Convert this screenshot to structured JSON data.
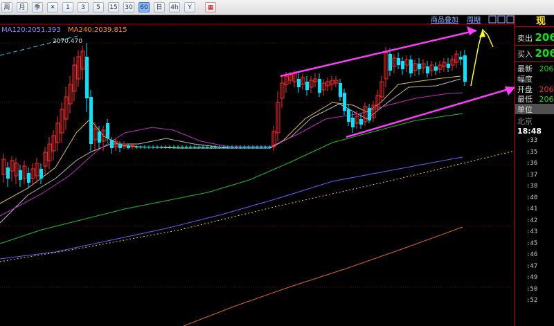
{
  "toolbar": {
    "buttons": [
      {
        "label": "周",
        "name": "weekly-period-button"
      },
      {
        "label": "月",
        "name": "monthly-period-button"
      },
      {
        "label": "季",
        "name": "quarter-period-button"
      },
      {
        "label": "✕",
        "name": "crosshair-button"
      },
      {
        "label": "1",
        "name": "period-1min-button"
      },
      {
        "label": "3",
        "name": "period-3min-button"
      },
      {
        "label": "5",
        "name": "period-5min-button"
      },
      {
        "label": "15",
        "name": "period-15min-button"
      },
      {
        "label": "30",
        "name": "period-30min-button"
      },
      {
        "label": "60",
        "name": "period-60min-button",
        "active": true
      },
      {
        "label": "日",
        "name": "daily-period-button"
      },
      {
        "label": "4h",
        "name": "period-4h-button"
      },
      {
        "label": "Y",
        "name": "indicator-button"
      },
      {
        "label": "▦",
        "name": "grid-toggle-button",
        "red": true
      }
    ]
  },
  "chart": {
    "indicators": {
      "ma120": "MA120:2051.393",
      "ma240": "MA240:2039.815"
    },
    "high_label": "2070.470",
    "links": {
      "overlay": "商品叠加",
      "period": "周期"
    },
    "window_icons": [
      "restore-icon",
      "minimize-icon",
      "maximize-icon"
    ]
  },
  "right_panel": {
    "title": "现",
    "sell_label": "卖出",
    "sell_value": "206",
    "buy_label": "买入",
    "buy_value": "206",
    "latest_label": "最新",
    "latest_value": "206",
    "change_label": "幅度",
    "open_label": "开盘",
    "open_value": "206",
    "low_label": "最低",
    "low_value": "206",
    "unit_label": "单位",
    "city": "北京",
    "time": "18:48",
    "ticks": [
      ":33",
      ":35",
      ":36",
      ":37",
      ":38",
      ":40",
      ":41",
      ":42",
      ":43",
      ":45",
      ":46",
      ":47",
      ":49",
      ":50",
      ":52"
    ]
  },
  "colors": {
    "up": "#ff2a2a",
    "down": "#00e5ff",
    "ma5": "#e8e8e8",
    "ma10": "#e3c44f",
    "ma20": "#c02fc0",
    "ma60": "#20c020",
    "ma120": "#6464ff",
    "ma240": "#e06a1a",
    "annot_magenta": "#ff3cff",
    "annot_yellow": "#ffff20"
  }
}
